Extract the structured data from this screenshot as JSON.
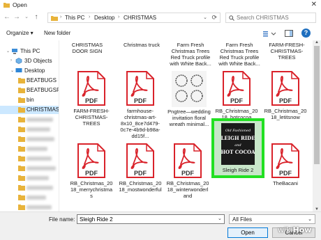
{
  "window": {
    "title": "Open"
  },
  "address": {
    "crumbs": [
      "This PC",
      "Desktop",
      "CHRISTMAS"
    ]
  },
  "search": {
    "placeholder": "Search CHRISTMAS"
  },
  "toolbar": {
    "organize_label": "Organize ▾",
    "new_folder_label": "New folder",
    "help_label": "?"
  },
  "sidebar": {
    "items": [
      {
        "label": "This PC",
        "icon": "pc-icon"
      },
      {
        "label": "3D Objects",
        "icon": "cube-icon"
      },
      {
        "label": "Desktop",
        "icon": "desktop-icon"
      },
      {
        "label": "BEATBUGS",
        "icon": "folder-icon"
      },
      {
        "label": "BEATBUGSFAV",
        "icon": "folder-icon"
      },
      {
        "label": "bin",
        "icon": "folder-icon"
      },
      {
        "label": "CHRISTMAS",
        "icon": "folder-icon"
      }
    ]
  },
  "files": {
    "row0": [
      "CHRISTMAS DOOR SIGN",
      "Christmas truck",
      "Farm Fresh Christmas Trees Red Truck profile with White Back...",
      "",
      "Farm Fresh Christmas Trees Red Truck profile with White Back...",
      "FARM-FRESH-CHRISTMAS-TREES"
    ],
    "row1": [
      {
        "name": "FARM-FRESH-CHRISTMAS-TREES",
        "type": "pdf"
      },
      {
        "name": "farmhouse-christmas-art-8x10_8ce7d479-0c7e-4b9d-b98a-dd15f...",
        "type": "pdf"
      },
      {
        "name": "Pngtree—wedding invitation floral wreath minimal...",
        "type": "image"
      },
      {
        "name": "RB_Christmas_2018_hotcocoa",
        "type": "pdf"
      },
      {
        "name": "RB_Christmas_2018_letitsnow",
        "type": "pdf"
      }
    ],
    "row2": [
      {
        "name": "RB_Christmas_2018_merrychristmas",
        "type": "pdf"
      },
      {
        "name": "RB_Christmas_2018_mostwonderful",
        "type": "pdf"
      },
      {
        "name": "RB_Christmas_2018_winterwonderland",
        "type": "pdf"
      },
      {
        "name": "Sleigh Ride 2",
        "type": "image",
        "selected": true
      },
      {
        "name": "TheBacani",
        "type": "pdf"
      }
    ],
    "pdf_badge": "PDF",
    "sleigh_text": [
      "Old Fashioned",
      "SLEIGH RIDES",
      "and",
      "HOT COCOA"
    ]
  },
  "bottom": {
    "file_name_label": "File name:",
    "file_name_value": "Sleigh Ride 2",
    "filter_value": "All Files",
    "open_label": "Open",
    "cancel_label": "Cancel"
  },
  "watermark": {
    "prefix": "wiki",
    "suffix": "How"
  },
  "colors": {
    "pdf_red": "#d9222a",
    "selection_green": "#22e022",
    "nav_selected": "#cce8ff"
  }
}
